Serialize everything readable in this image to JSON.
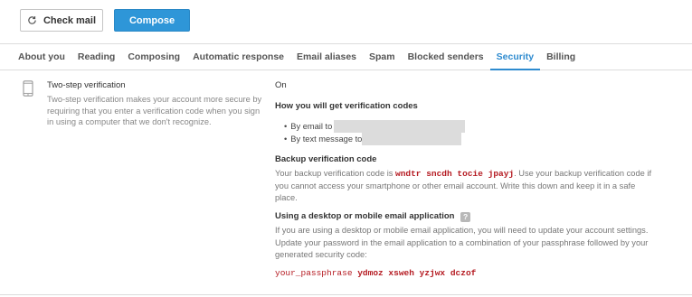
{
  "toolbar": {
    "check_mail_label": "Check mail",
    "compose_label": "Compose"
  },
  "tabs": [
    {
      "label": "About you",
      "active": false
    },
    {
      "label": "Reading",
      "active": false
    },
    {
      "label": "Composing",
      "active": false
    },
    {
      "label": "Automatic response",
      "active": false
    },
    {
      "label": "Email aliases",
      "active": false
    },
    {
      "label": "Spam",
      "active": false
    },
    {
      "label": "Blocked senders",
      "active": false
    },
    {
      "label": "Security",
      "active": true
    },
    {
      "label": "Billing",
      "active": false
    }
  ],
  "section": {
    "title": "Two-step verification",
    "description": "Two-step verification makes your account more secure by requiring that you enter a verification code when you sign in using a computer that we don't recognize.",
    "status": "On",
    "icon": "phone-icon"
  },
  "codes": {
    "heading": "How you will get verification codes",
    "by_email": "By email to",
    "by_text": "By text message to"
  },
  "backup": {
    "heading": "Backup verification code",
    "pre": "Your backup verification code is",
    "code": "wndtr sncdh tocie jpayj",
    "post": ". Use your backup verification code if you cannot access your smartphone or other email account. Write this down and keep it in a safe place."
  },
  "app": {
    "heading": "Using a desktop or mobile email application",
    "help_icon": "?",
    "text": "If you are using a desktop or mobile email application, you will need to update your account settings. Update your password in the email application to a combination of your passphrase followed by your generated security code:",
    "pass_prefix": "your_passphrase",
    "pass_code": "ydmoz xsweh yzjwx dczof"
  },
  "colors": {
    "accent": "#2e96d8",
    "active_tab": "#2e8bcf",
    "code_red": "#b51b22"
  }
}
